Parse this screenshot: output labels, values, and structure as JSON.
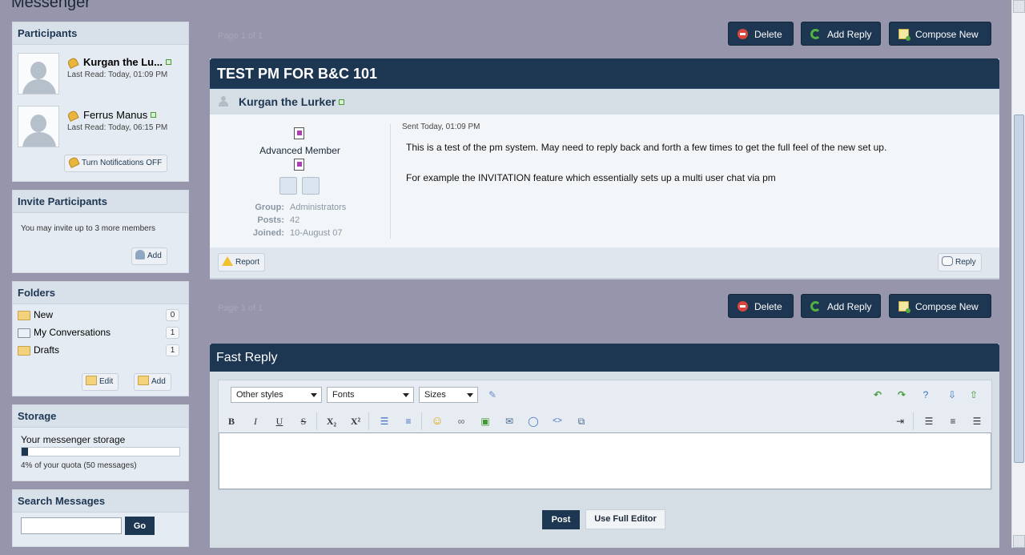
{
  "page_title": "Messenger",
  "sidebar": {
    "participants": {
      "title": "Participants",
      "people": [
        {
          "name": "Kurgan the Lu...",
          "last_read": "Last Read: Today, 01:09 PM"
        },
        {
          "name": "Ferrus Manus",
          "last_read": "Last Read: Today, 06:15 PM"
        }
      ],
      "notify_button": "Turn Notifications OFF"
    },
    "invite": {
      "title": "Invite Participants",
      "text": "You may invite up to 3 more members",
      "add_button": "Add"
    },
    "folders": {
      "title": "Folders",
      "items": [
        {
          "label": "New",
          "count": "0"
        },
        {
          "label": "My Conversations",
          "count": "1"
        },
        {
          "label": "Drafts",
          "count": "1"
        }
      ],
      "edit_button": "Edit",
      "add_button": "Add"
    },
    "storage": {
      "title": "Storage",
      "label": "Your messenger storage",
      "percent": 4,
      "quota_text": "4% of your quota (50 messages)"
    },
    "search": {
      "title": "Search Messages",
      "value": "",
      "go_button": "Go"
    }
  },
  "pagination": {
    "text": "Page 1 of 1"
  },
  "actions": {
    "delete": "Delete",
    "add_reply": "Add Reply",
    "compose_new": "Compose New"
  },
  "message": {
    "title": "TEST PM FOR B&C 101",
    "author": "Kurgan the Lurker",
    "rank": "Advanced Member",
    "group_label": "Group:",
    "group": "Administrators",
    "posts_label": "Posts:",
    "posts": "42",
    "joined_label": "Joined:",
    "joined": "10-August 07",
    "sent": "Sent Today, 01:09 PM",
    "paragraphs": [
      "This is a test of the pm system. May need to reply back and forth a few times to get the full feel of the new set up.",
      "For example the INVITATION feature which essentially sets up a multi user chat via pm"
    ],
    "report_button": "Report",
    "reply_button": "Reply"
  },
  "fast_reply": {
    "title": "Fast Reply",
    "styles_select": "Other styles",
    "fonts_select": "Fonts",
    "sizes_select": "Sizes",
    "text": "",
    "post_button": "Post",
    "full_editor_button": "Use Full Editor"
  }
}
